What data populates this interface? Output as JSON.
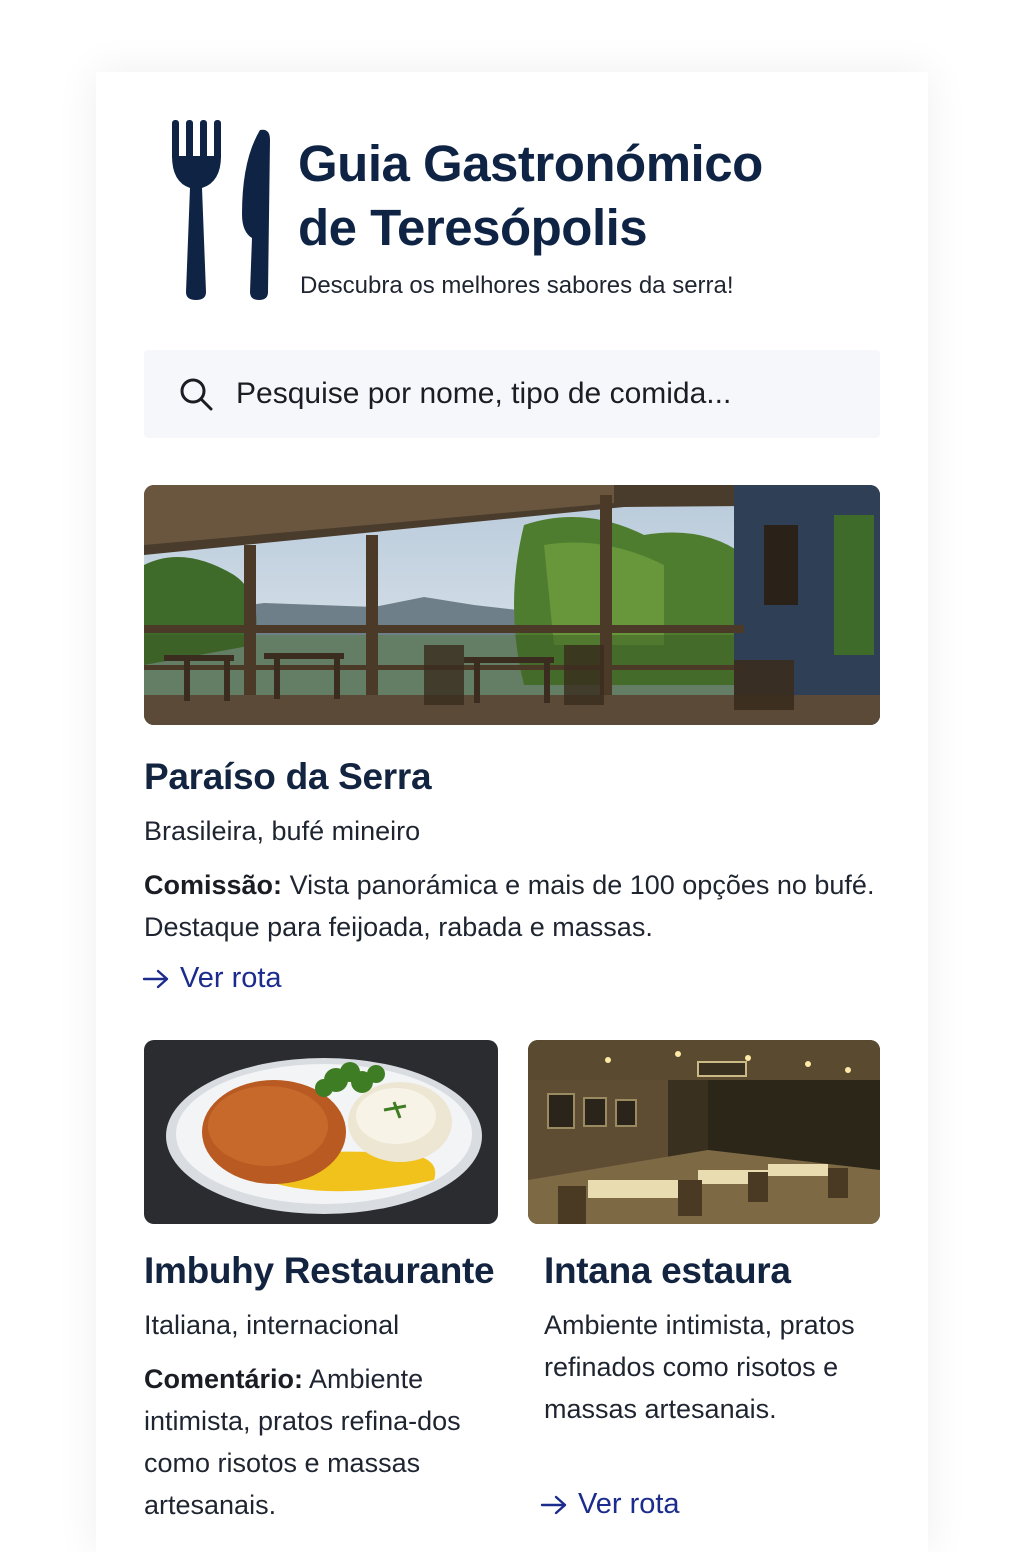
{
  "header": {
    "title": "Guia Gastronómico\nde Teresópolis",
    "subtitle": "Descubra os melhores sabores da serra!",
    "logo_icon": "fork-and-knife-icon"
  },
  "search": {
    "placeholder": "Pesquise por nome, tipo de comida...",
    "icon": "search-icon"
  },
  "restaurants": [
    {
      "name": "Paraíso da Serra",
      "category": "Brasileira, bufé mineiro",
      "desc_label": "Comissão:",
      "description": "Vista panorámica e mais de 100 opções no bufé. Destaque para feijoada, rabada e massas.",
      "route_label": "Ver rota"
    },
    {
      "name": "Imbuhy Restaurante",
      "category": "Italiana, internacional",
      "desc_label": "Comentário:",
      "description": "Ambiente intimista, pratos refina-dos como risotos e massas artesanais."
    },
    {
      "name": "Intana estaura",
      "description": "Ambiente intimista, pratos refinados como risotos e massas artesanais.",
      "route_label": "Ver rota"
    }
  ],
  "colors": {
    "title": "#0f2444",
    "link": "#1c2c8c",
    "search_bg": "#f5f7fa"
  }
}
